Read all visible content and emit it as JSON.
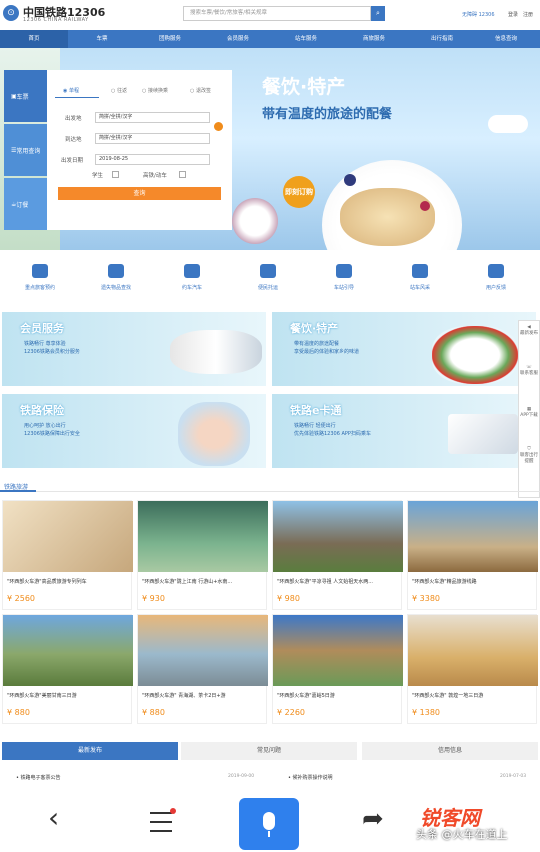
{
  "header": {
    "logo_title": "中国铁路12306",
    "logo_sub": "12306 CHINA RAILWAY",
    "search_placeholder": "搜索车票/餐饮/常旅客/相关规章",
    "accessibility": "无障碍 12306",
    "login": "登录",
    "register": "注册"
  },
  "nav": [
    "首页",
    "车票",
    "团购服务",
    "会员服务",
    "站车服务",
    "商旅服务",
    "出行指南",
    "信息查询"
  ],
  "hero": {
    "title": "餐饮·特产",
    "subtitle": "带有温度的旅途的配餐",
    "badge": "即刻订购"
  },
  "side_tabs": [
    "车票",
    "常用查询",
    "订餐"
  ],
  "form": {
    "trip_types": [
      "单程",
      "往返",
      "接续换乘",
      "退改签"
    ],
    "from_label": "出发地",
    "from_value": "简拼/全拼/汉字",
    "to_label": "到达地",
    "to_value": "简拼/全拼/汉字",
    "date_label": "出发日期",
    "date_value": "2019-08-25",
    "student": "学生",
    "highspeed": "高铁/动车",
    "query_button": "查询"
  },
  "quick_links": [
    "重点旅客预约",
    "遗失物品查找",
    "约车汽车",
    "便民托运",
    "车站引导",
    "站车风采",
    "用户反馈"
  ],
  "promos": [
    {
      "title": "会员服务",
      "l1": "铁路畅行 尊享体验",
      "l2": "12306铁路会员积分服务"
    },
    {
      "title": "餐饮·特产",
      "l1": "带有温度的旅途配餐",
      "l2": "享受最后的体验和家乡的味道"
    },
    {
      "title": "铁路保险",
      "l1": "用心呵护 放心出行",
      "l2": "12306铁路保障出行安全"
    },
    {
      "title": "铁路e卡通",
      "l1": "铁路畅行 轻便出行",
      "l2": "优先体验铁路12306 APP扫码乘车"
    }
  ],
  "rail_items": [
    "最新发布",
    "联系客服",
    "APP下载",
    "联客出行提醒"
  ],
  "tour_section": "铁路旅游",
  "tours": [
    {
      "title": "\"环西部火车游\"高品质旅游专列列车",
      "price": "¥ 2560"
    },
    {
      "title": "\"环西部火车游\"陇上江南 行游山+水南...",
      "price": "¥ 930"
    },
    {
      "title": "\"环西部火车游\"平凉寻祖 人文始祖天水两...",
      "price": "¥ 980"
    },
    {
      "title": "\"环西部火车游\"精品旅游线路",
      "price": "¥ 3380"
    },
    {
      "title": "\"环西部火车游\"美丽甘南三日游",
      "price": "¥ 880"
    },
    {
      "title": "\"环西部火车游\" 青海湖、茶卡2日+游",
      "price": "¥ 880"
    },
    {
      "title": "\"环西部火车游\"嘉峪5日游",
      "price": "¥ 2260"
    },
    {
      "title": "\"环西部火车游\" 敦煌一地三日游",
      "price": "¥ 1380"
    }
  ],
  "news": {
    "tabs": [
      "最新发布",
      "常见问题",
      "信用信息"
    ],
    "left_item": "铁路电子客票公告",
    "left_date": "2019-09-00",
    "right_item": "候补购票操作说明",
    "right_date": "2019-07-03"
  },
  "watermark": {
    "logo": "锐客网",
    "sub": "头条 @火车在道上"
  },
  "colors": {
    "brand": "#3b76c2",
    "accent": "#f5892a"
  }
}
